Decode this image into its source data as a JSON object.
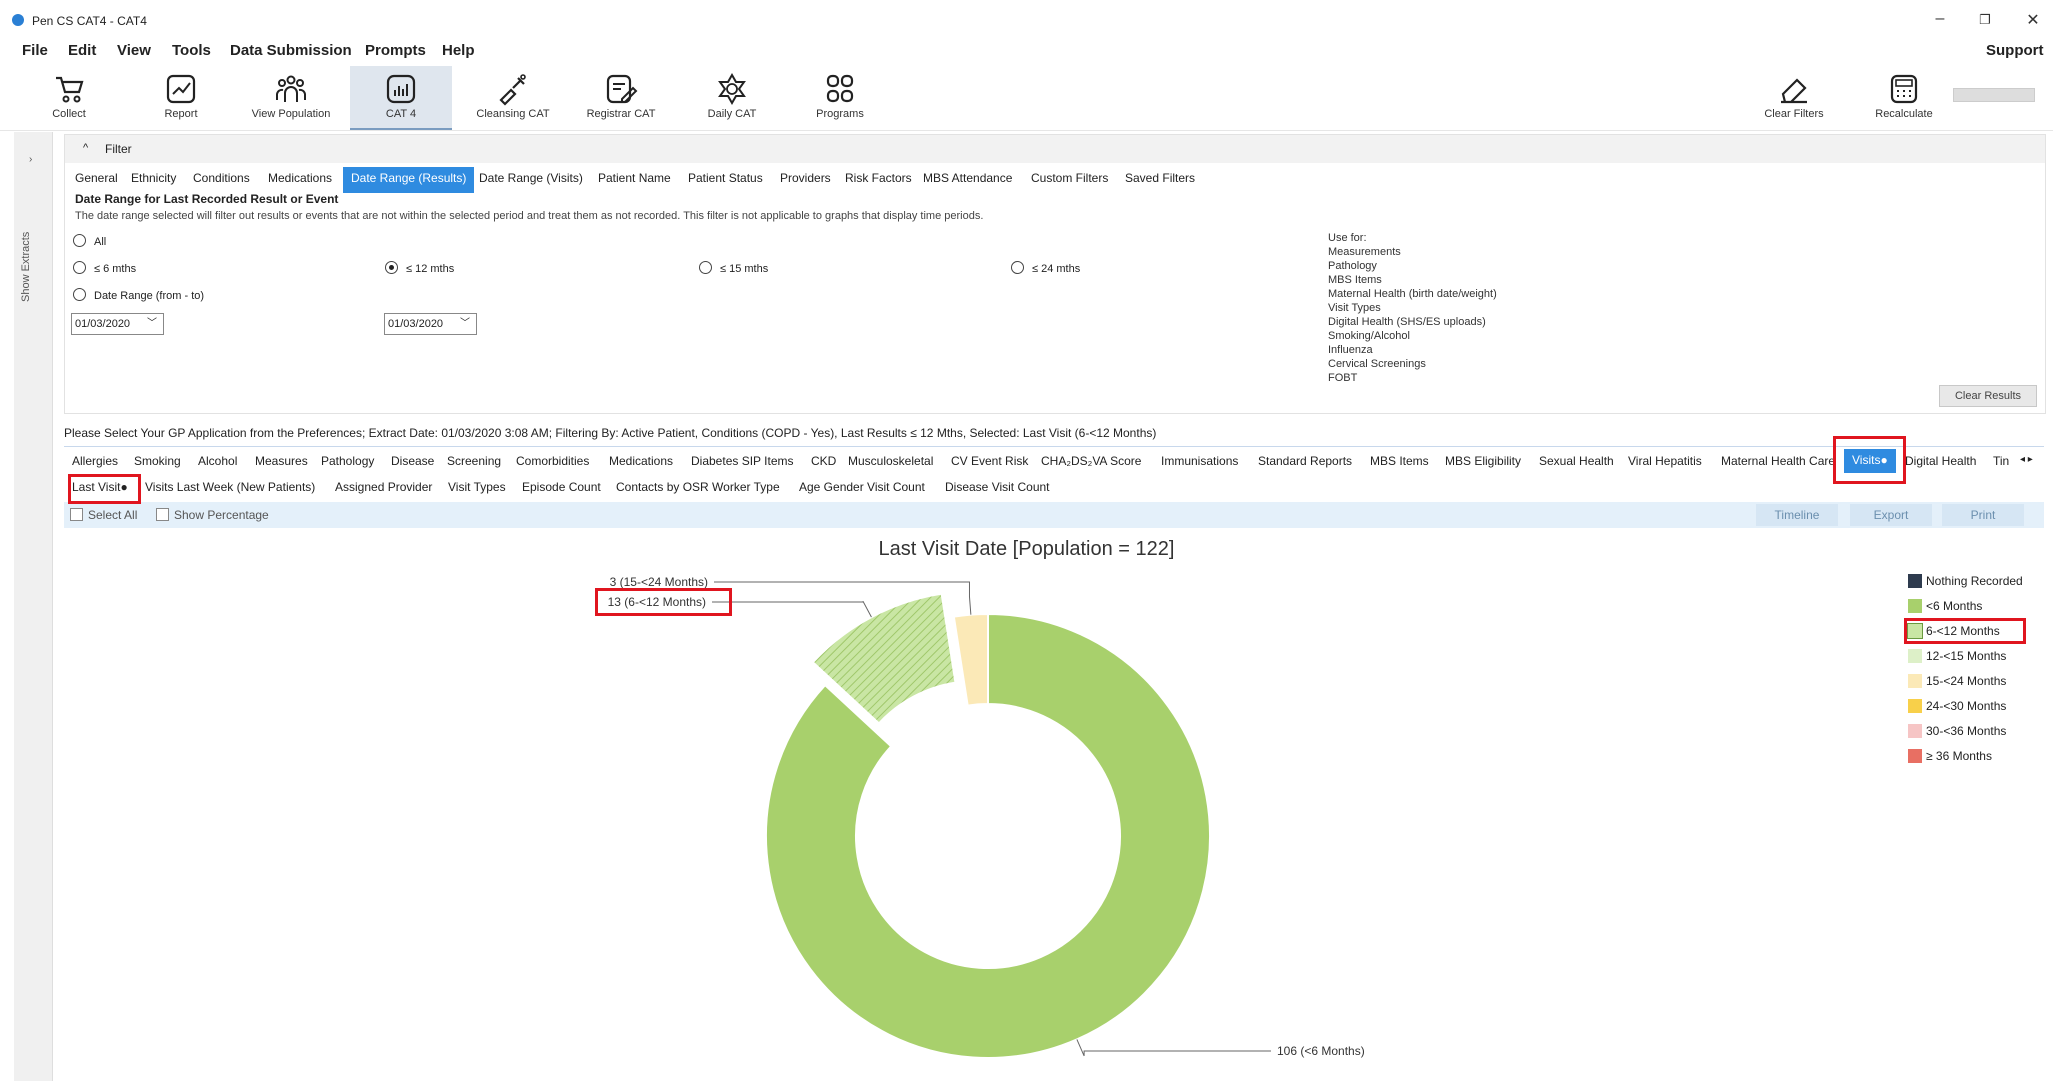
{
  "window": {
    "title": "Pen CS CAT4 - CAT4",
    "controls": {
      "minimize": "–",
      "restore": "❐",
      "close": "✕"
    }
  },
  "menu": {
    "items": [
      "File",
      "Edit",
      "View",
      "Tools",
      "Data Submission",
      "Prompts",
      "Help"
    ],
    "support": "Support"
  },
  "toolbar": {
    "buttons": [
      {
        "label": "Collect",
        "icon": "cart-icon"
      },
      {
        "label": "Report",
        "icon": "report-icon"
      },
      {
        "label": "View Population",
        "icon": "population-icon"
      },
      {
        "label": "CAT 4",
        "icon": "cat4-icon",
        "active": true
      },
      {
        "label": "Cleansing CAT",
        "icon": "cleansing-icon"
      },
      {
        "label": "Registrar CAT",
        "icon": "registrar-icon"
      },
      {
        "label": "Daily CAT",
        "icon": "daily-icon"
      },
      {
        "label": "Programs",
        "icon": "programs-icon"
      }
    ],
    "right_buttons": [
      {
        "label": "Clear Filters",
        "icon": "eraser-icon"
      },
      {
        "label": "Recalculate",
        "icon": "calculator-icon"
      }
    ]
  },
  "sidebar": {
    "toggle": "›",
    "label": "Show Extracts"
  },
  "filter": {
    "header": "Filter",
    "collapse_glyph": "^",
    "tabs": [
      "General",
      "Ethnicity",
      "Conditions",
      "Medications",
      "Date Range (Results)",
      "Date Range (Visits)",
      "Patient Name",
      "Patient Status",
      "Providers",
      "Risk Factors",
      "MBS Attendance",
      "Custom Filters",
      "Saved Filters"
    ],
    "selected_tab": "Date Range (Results)",
    "section_title": "Date Range for Last Recorded Result or Event",
    "description": "The date range selected will filter out results or events that are not within the selected period and treat them as not recorded. This filter is not applicable to graphs that display time periods.",
    "options": {
      "all": "All",
      "m6": "≤ 6 mths",
      "m12": "≤ 12 mths",
      "m15": "≤ 15 mths",
      "m24": "≤ 24 mths",
      "range": "Date Range (from - to)"
    },
    "selected_option": "≤ 12 mths",
    "from_date": "01/03/2020",
    "to_date": "01/03/2020",
    "use_for_title": "Use for:",
    "use_for": [
      "Measurements",
      "Pathology",
      "MBS Items",
      "Maternal Health (birth date/weight)",
      "Visit Types",
      "Digital Health (SHS/ES uploads)",
      "Smoking/Alcohol",
      "Influenza",
      "Cervical Screenings",
      "FOBT"
    ],
    "clear_results": "Clear Results"
  },
  "status_line": "Please Select Your GP Application from the Preferences; Extract Date: 01/03/2020 3:08 AM; Filtering By: Active Patient, Conditions (COPD - Yes), Last Results ≤ 12 Mths, Selected: Last Visit (6-<12 Months)",
  "report_tabs": [
    "Allergies",
    "Smoking",
    "Alcohol",
    "Measures",
    "Pathology",
    "Disease",
    "Screening",
    "Comorbidities",
    "Medications",
    "Diabetes SIP Items",
    "CKD",
    "Musculoskeletal",
    "CV Event Risk",
    "CHA₂DS₂VA Score",
    "Immunisations",
    "Standard Reports",
    "MBS Items",
    "MBS Eligibility",
    "Sexual Health",
    "Viral Hepatitis",
    "Maternal Health Care",
    "Visits●",
    "Digital Health",
    "Tin"
  ],
  "report_tabs_scroll": "◂ ▸",
  "sub_tabs": [
    "Last Visit●",
    "Visits Last Week (New Patients)",
    "Assigned Provider",
    "Visit Types",
    "Episode Count",
    "Contacts by OSR Worker Type",
    "Age Gender Visit Count",
    "Disease Visit Count"
  ],
  "actions": {
    "select_all": "Select All",
    "show_percentage": "Show Percentage",
    "timeline": "Timeline",
    "export": "Export",
    "print": "Print"
  },
  "chart_data": {
    "type": "pie",
    "donut": true,
    "title": "Last Visit Date [Population = 122]",
    "population": 122,
    "categories": [
      "Nothing Recorded",
      "<6 Months",
      "6-<12 Months",
      "12-<15 Months",
      "15-<24 Months",
      "24-<30 Months",
      "30-<36 Months",
      "≥ 36 Months"
    ],
    "values": [
      0,
      106,
      13,
      0,
      3,
      0,
      0,
      0
    ],
    "colors": [
      "#2e3b4e",
      "#a8d06c",
      "#c9e6a4",
      "#ddf0c8",
      "#fbe9b7",
      "#f8d04a",
      "#f6c5c5",
      "#e86f63"
    ],
    "selected": "6-<12 Months",
    "data_labels": [
      "106 (<6 Months)",
      "13 (6-<12 Months)",
      "3 (15-<24 Months)"
    ],
    "legend_position": "right"
  }
}
